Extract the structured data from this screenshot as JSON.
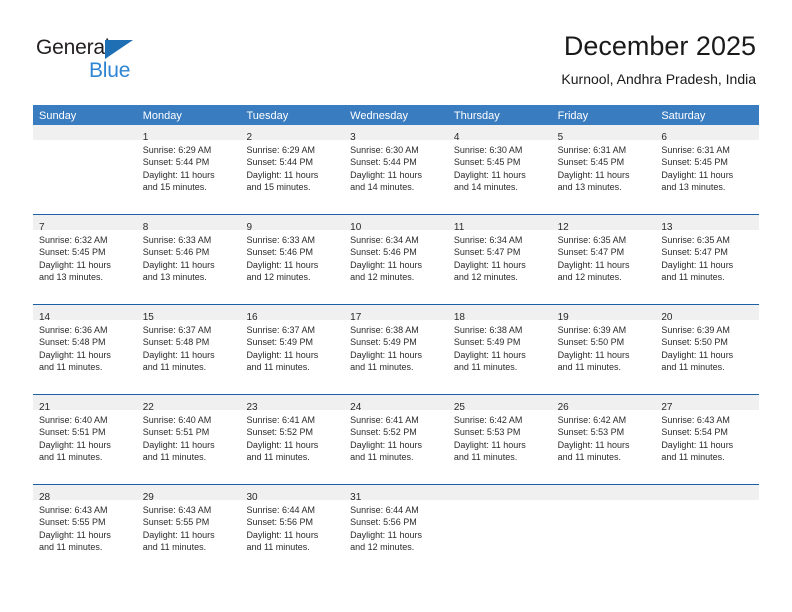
{
  "brand": {
    "name_part1": "General",
    "name_part2": "Blue",
    "triangle_color": "#1f6fb5",
    "blue_color": "#2e85d3"
  },
  "header": {
    "title": "December 2025",
    "subtitle": "Kurnool, Andhra Pradesh, India"
  },
  "colors": {
    "header_bar": "#3a7cc0",
    "week_divider": "#1f5fa3",
    "daynum_band": "#f0f0f0"
  },
  "weekdays": [
    "Sunday",
    "Monday",
    "Tuesday",
    "Wednesday",
    "Thursday",
    "Friday",
    "Saturday"
  ],
  "weeks": [
    [
      {
        "day": "",
        "lines": []
      },
      {
        "day": "1",
        "lines": [
          "Sunrise: 6:29 AM",
          "Sunset: 5:44 PM",
          "Daylight: 11 hours",
          "and 15 minutes."
        ]
      },
      {
        "day": "2",
        "lines": [
          "Sunrise: 6:29 AM",
          "Sunset: 5:44 PM",
          "Daylight: 11 hours",
          "and 15 minutes."
        ]
      },
      {
        "day": "3",
        "lines": [
          "Sunrise: 6:30 AM",
          "Sunset: 5:44 PM",
          "Daylight: 11 hours",
          "and 14 minutes."
        ]
      },
      {
        "day": "4",
        "lines": [
          "Sunrise: 6:30 AM",
          "Sunset: 5:45 PM",
          "Daylight: 11 hours",
          "and 14 minutes."
        ]
      },
      {
        "day": "5",
        "lines": [
          "Sunrise: 6:31 AM",
          "Sunset: 5:45 PM",
          "Daylight: 11 hours",
          "and 13 minutes."
        ]
      },
      {
        "day": "6",
        "lines": [
          "Sunrise: 6:31 AM",
          "Sunset: 5:45 PM",
          "Daylight: 11 hours",
          "and 13 minutes."
        ]
      }
    ],
    [
      {
        "day": "7",
        "lines": [
          "Sunrise: 6:32 AM",
          "Sunset: 5:45 PM",
          "Daylight: 11 hours",
          "and 13 minutes."
        ]
      },
      {
        "day": "8",
        "lines": [
          "Sunrise: 6:33 AM",
          "Sunset: 5:46 PM",
          "Daylight: 11 hours",
          "and 13 minutes."
        ]
      },
      {
        "day": "9",
        "lines": [
          "Sunrise: 6:33 AM",
          "Sunset: 5:46 PM",
          "Daylight: 11 hours",
          "and 12 minutes."
        ]
      },
      {
        "day": "10",
        "lines": [
          "Sunrise: 6:34 AM",
          "Sunset: 5:46 PM",
          "Daylight: 11 hours",
          "and 12 minutes."
        ]
      },
      {
        "day": "11",
        "lines": [
          "Sunrise: 6:34 AM",
          "Sunset: 5:47 PM",
          "Daylight: 11 hours",
          "and 12 minutes."
        ]
      },
      {
        "day": "12",
        "lines": [
          "Sunrise: 6:35 AM",
          "Sunset: 5:47 PM",
          "Daylight: 11 hours",
          "and 12 minutes."
        ]
      },
      {
        "day": "13",
        "lines": [
          "Sunrise: 6:35 AM",
          "Sunset: 5:47 PM",
          "Daylight: 11 hours",
          "and 11 minutes."
        ]
      }
    ],
    [
      {
        "day": "14",
        "lines": [
          "Sunrise: 6:36 AM",
          "Sunset: 5:48 PM",
          "Daylight: 11 hours",
          "and 11 minutes."
        ]
      },
      {
        "day": "15",
        "lines": [
          "Sunrise: 6:37 AM",
          "Sunset: 5:48 PM",
          "Daylight: 11 hours",
          "and 11 minutes."
        ]
      },
      {
        "day": "16",
        "lines": [
          "Sunrise: 6:37 AM",
          "Sunset: 5:49 PM",
          "Daylight: 11 hours",
          "and 11 minutes."
        ]
      },
      {
        "day": "17",
        "lines": [
          "Sunrise: 6:38 AM",
          "Sunset: 5:49 PM",
          "Daylight: 11 hours",
          "and 11 minutes."
        ]
      },
      {
        "day": "18",
        "lines": [
          "Sunrise: 6:38 AM",
          "Sunset: 5:49 PM",
          "Daylight: 11 hours",
          "and 11 minutes."
        ]
      },
      {
        "day": "19",
        "lines": [
          "Sunrise: 6:39 AM",
          "Sunset: 5:50 PM",
          "Daylight: 11 hours",
          "and 11 minutes."
        ]
      },
      {
        "day": "20",
        "lines": [
          "Sunrise: 6:39 AM",
          "Sunset: 5:50 PM",
          "Daylight: 11 hours",
          "and 11 minutes."
        ]
      }
    ],
    [
      {
        "day": "21",
        "lines": [
          "Sunrise: 6:40 AM",
          "Sunset: 5:51 PM",
          "Daylight: 11 hours",
          "and 11 minutes."
        ]
      },
      {
        "day": "22",
        "lines": [
          "Sunrise: 6:40 AM",
          "Sunset: 5:51 PM",
          "Daylight: 11 hours",
          "and 11 minutes."
        ]
      },
      {
        "day": "23",
        "lines": [
          "Sunrise: 6:41 AM",
          "Sunset: 5:52 PM",
          "Daylight: 11 hours",
          "and 11 minutes."
        ]
      },
      {
        "day": "24",
        "lines": [
          "Sunrise: 6:41 AM",
          "Sunset: 5:52 PM",
          "Daylight: 11 hours",
          "and 11 minutes."
        ]
      },
      {
        "day": "25",
        "lines": [
          "Sunrise: 6:42 AM",
          "Sunset: 5:53 PM",
          "Daylight: 11 hours",
          "and 11 minutes."
        ]
      },
      {
        "day": "26",
        "lines": [
          "Sunrise: 6:42 AM",
          "Sunset: 5:53 PM",
          "Daylight: 11 hours",
          "and 11 minutes."
        ]
      },
      {
        "day": "27",
        "lines": [
          "Sunrise: 6:43 AM",
          "Sunset: 5:54 PM",
          "Daylight: 11 hours",
          "and 11 minutes."
        ]
      }
    ],
    [
      {
        "day": "28",
        "lines": [
          "Sunrise: 6:43 AM",
          "Sunset: 5:55 PM",
          "Daylight: 11 hours",
          "and 11 minutes."
        ]
      },
      {
        "day": "29",
        "lines": [
          "Sunrise: 6:43 AM",
          "Sunset: 5:55 PM",
          "Daylight: 11 hours",
          "and 11 minutes."
        ]
      },
      {
        "day": "30",
        "lines": [
          "Sunrise: 6:44 AM",
          "Sunset: 5:56 PM",
          "Daylight: 11 hours",
          "and 11 minutes."
        ]
      },
      {
        "day": "31",
        "lines": [
          "Sunrise: 6:44 AM",
          "Sunset: 5:56 PM",
          "Daylight: 11 hours",
          "and 12 minutes."
        ]
      },
      {
        "day": "",
        "lines": []
      },
      {
        "day": "",
        "lines": []
      },
      {
        "day": "",
        "lines": []
      }
    ]
  ]
}
